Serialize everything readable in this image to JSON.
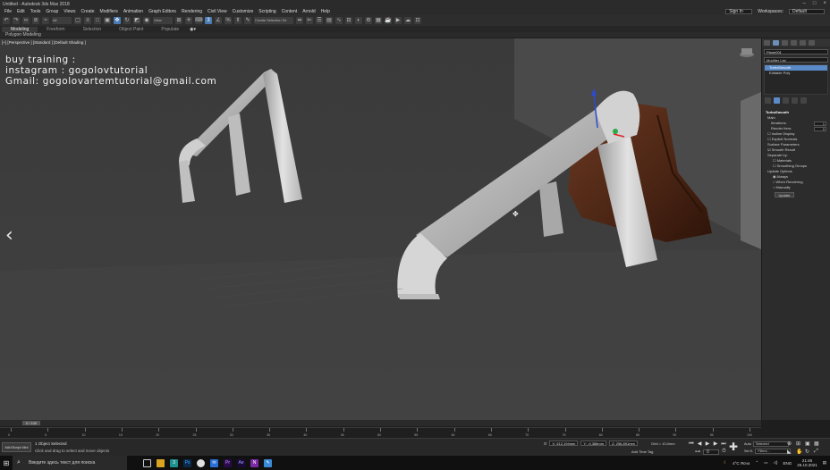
{
  "window": {
    "title": "Untitled - Autodesk 3ds Max 2018"
  },
  "menu": [
    "File",
    "Edit",
    "Tools",
    "Group",
    "Views",
    "Create",
    "Modifiers",
    "Animation",
    "Graph Editors",
    "Rendering",
    "Civil View",
    "Customize",
    "Scripting",
    "Content",
    "Arnold",
    "Help"
  ],
  "workspace": {
    "label": "Workspaces:",
    "value": "Default"
  },
  "signin": "Sign In",
  "toolbar": {
    "filter": "All",
    "refcoord": "View",
    "selection_set": "Create Selection Se"
  },
  "ribbon": {
    "tabs": [
      "Modeling",
      "Freeform",
      "Selection",
      "Object Paint",
      "Populate"
    ],
    "active": "Modeling",
    "sub": "Polygon Modeling"
  },
  "viewport": {
    "label": "[+] [Perspective ] [Standard ] [Default Shading ]",
    "overlay_lines": [
      "buy training :",
      "instagram : gogolovtutorial",
      "Gmail: gogolovartemtutorial@gmail.com"
    ],
    "nav_prev": "‹",
    "nav_next": "›"
  },
  "command_panel": {
    "object_name": "Plane001",
    "modifier_list": "Modifier List",
    "stack": [
      "TurboSmooth",
      "Editable Poly"
    ],
    "turbosmooth": {
      "title": "TurboSmooth",
      "main": "Main",
      "iterations_label": "Iterations:",
      "iterations": "1",
      "render_iters_label": "Render Iters:",
      "render_iters": "0",
      "isoline": "Isoline Display",
      "explicit": "Explicit Normals",
      "surface": "Surface Parameters",
      "smooth_result": "Smooth Result",
      "separate": "Separate by:",
      "materials": "Materials",
      "smoothing_groups": "Smoothing Groups",
      "update_options": "Update Options",
      "always": "Always",
      "when_rendering": "When Rendering",
      "manually": "Manually",
      "update_button": "Update"
    }
  },
  "timeline": {
    "slider": "0 / 100",
    "ticks": [
      "0",
      "5",
      "10",
      "15",
      "20",
      "25",
      "30",
      "35",
      "40",
      "45",
      "50",
      "55",
      "60",
      "65",
      "70",
      "75",
      "80",
      "85",
      "90",
      "95",
      "100"
    ]
  },
  "status": {
    "maxscript": "MAXScript Mini",
    "line1": "1 Object Selected",
    "line2": "Click and drag to select and move objects",
    "x": "X: 512,194mm",
    "y": "Y: -9,386mm",
    "z": "Z: 256,891mm",
    "grid": "Grid = 10,0mm",
    "add_time_tag": "Add Time Tag",
    "auto": "Auto",
    "selected": "Selected",
    "set_k": "Set K.",
    "filters": "Filters...",
    "frame": "0"
  },
  "taskbar": {
    "search_placeholder": "Введите здесь текст для поиска",
    "weather": "4°C  Ясно",
    "lang": "ENG",
    "time": "21:46",
    "date": "26.10.2021"
  }
}
